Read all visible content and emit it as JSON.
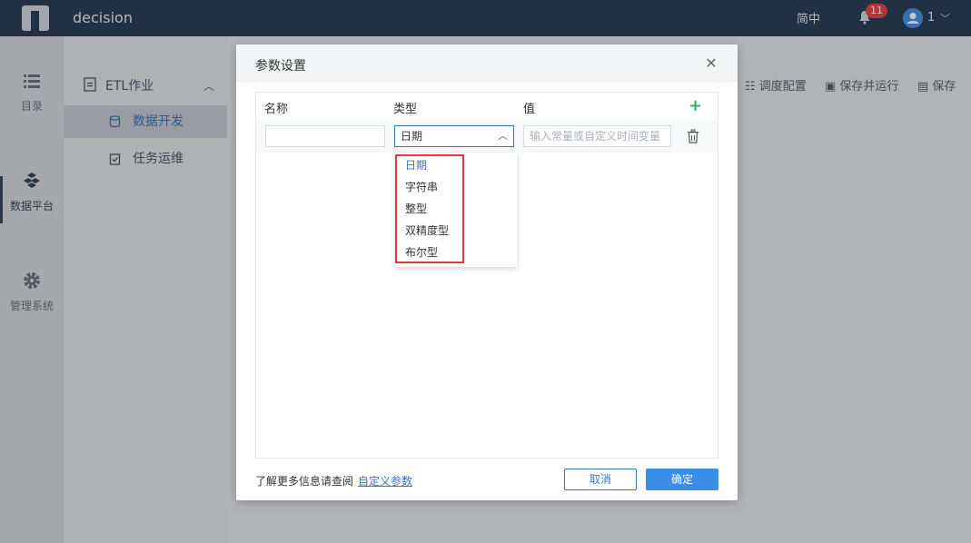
{
  "topbar": {
    "app_title": "decision",
    "language": "简中",
    "notification_count": "11",
    "user_name": "1"
  },
  "rail": {
    "items": [
      {
        "label": "目录",
        "icon": "list-icon"
      },
      {
        "label": "数据平台",
        "icon": "cubes-icon"
      },
      {
        "label": "管理系统",
        "icon": "gear-icon"
      }
    ]
  },
  "sidebar": {
    "group_label": "ETL作业",
    "items": [
      {
        "label": "数据开发",
        "active": true
      },
      {
        "label": "任务运维",
        "active": false
      }
    ]
  },
  "toolbar": {
    "schedule_label": "调度配置",
    "save_run_label": "保存并运行",
    "save_label": "保存"
  },
  "dialog": {
    "title": "参数设置",
    "columns": {
      "name": "名称",
      "type": "类型",
      "value": "值"
    },
    "row": {
      "name_value": "",
      "type_value": "日期",
      "value_placeholder": "输入常量或自定义时间变量"
    },
    "type_options": [
      "日期",
      "字符串",
      "整型",
      "双精度型",
      "布尔型"
    ],
    "footer_text": "了解更多信息请查阅",
    "footer_link": "自定义参数",
    "cancel_label": "取消",
    "ok_label": "确定"
  },
  "colors": {
    "topbar": "#2c3e56",
    "accent": "#3b73b9",
    "primary_button": "#3b8ee8",
    "add_green": "#2fb36b",
    "highlight_red": "#e0393e"
  }
}
